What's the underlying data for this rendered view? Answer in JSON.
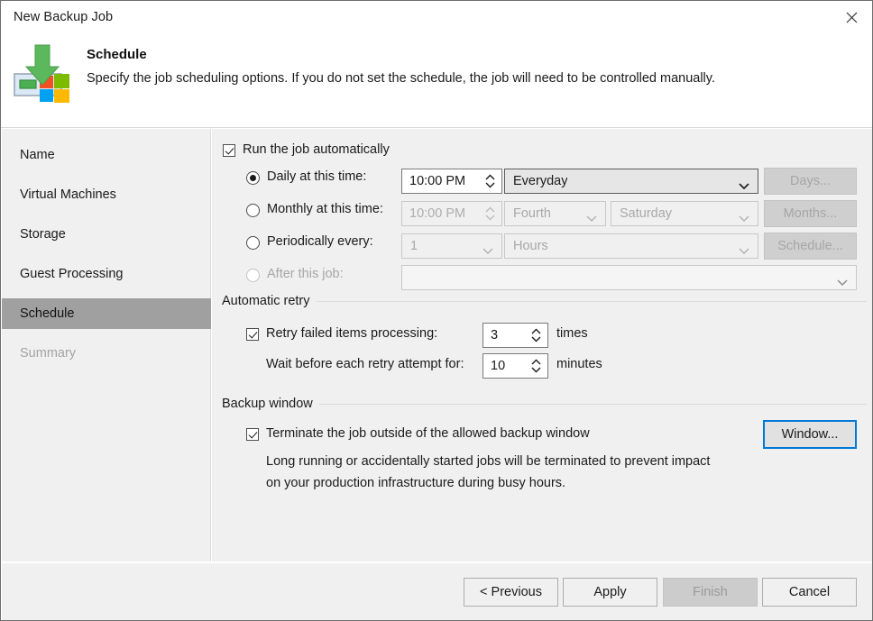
{
  "window": {
    "title": "New Backup Job",
    "close_icon": "close-icon"
  },
  "header": {
    "title": "Schedule",
    "description": "Specify the job scheduling options. If you do not set the schedule, the job will need to be controlled manually.",
    "icon": "backup-job-schedule-icon"
  },
  "sidebar": {
    "items": [
      {
        "label": "Name",
        "state": "normal"
      },
      {
        "label": "Virtual Machines",
        "state": "normal"
      },
      {
        "label": "Storage",
        "state": "normal"
      },
      {
        "label": "Guest Processing",
        "state": "normal"
      },
      {
        "label": "Schedule",
        "state": "selected"
      },
      {
        "label": "Summary",
        "state": "disabled"
      }
    ]
  },
  "main": {
    "run_automatically": {
      "label": "Run the job automatically",
      "checked": true
    },
    "daily": {
      "radio_label": "Daily at this time:",
      "selected": true,
      "time_value": "10:00 PM",
      "period_value": "Everyday",
      "button_label": "Days...",
      "button_enabled": false
    },
    "monthly": {
      "radio_label": "Monthly at this time:",
      "selected": false,
      "time_value": "10:00 PM",
      "ordinal_value": "Fourth",
      "weekday_value": "Saturday",
      "button_label": "Months...",
      "button_enabled": false
    },
    "periodically": {
      "radio_label": "Periodically every:",
      "selected": false,
      "count_value": "1",
      "unit_value": "Hours",
      "button_label": "Schedule...",
      "button_enabled": false
    },
    "after_this_job": {
      "radio_label": "After this job:",
      "selected": false,
      "enabled": false,
      "job_value": ""
    },
    "automatic_retry": {
      "section_label": "Automatic retry",
      "retry_checkbox_label": "Retry failed items processing:",
      "retry_checked": true,
      "retry_times_value": "3",
      "retry_times_suffix": "times",
      "wait_label": "Wait before each retry attempt for:",
      "wait_value": "10",
      "wait_suffix": "minutes"
    },
    "backup_window": {
      "section_label": "Backup window",
      "terminate_label": "Terminate the job outside of the allowed backup window",
      "terminate_checked": true,
      "description_line1": "Long running or accidentally started jobs will be terminated to prevent impact",
      "description_line2": "on your production infrastructure during busy hours.",
      "window_button_label": "Window..."
    }
  },
  "footer": {
    "previous_label": "< Previous",
    "apply_label": "Apply",
    "finish_label": "Finish",
    "finish_enabled": false,
    "cancel_label": "Cancel"
  },
  "colors": {
    "accent": "#0078d7",
    "selected_nav": "#a0a0a0",
    "surface": "#f0f0f0",
    "icon_green": "#4caf50",
    "icon_red": "#f25022",
    "icon_lime": "#7cbb00",
    "icon_blue": "#00a1f1",
    "icon_yellow": "#ffb900"
  }
}
